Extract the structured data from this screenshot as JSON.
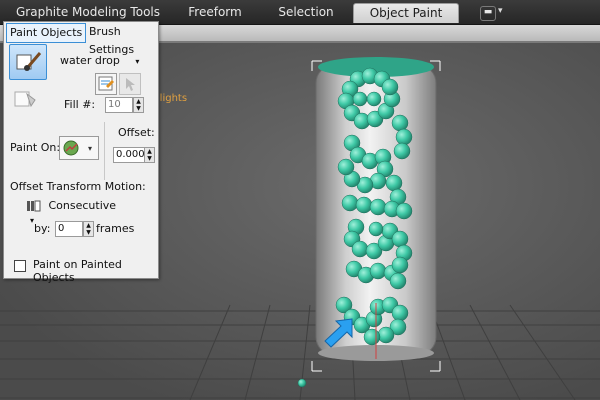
{
  "ribbon": {
    "tabs": [
      {
        "label": "Graphite Modeling Tools",
        "active": false
      },
      {
        "label": "Freeform",
        "active": false
      },
      {
        "label": "Selection",
        "active": false
      },
      {
        "label": "Object Paint",
        "active": true
      }
    ],
    "dropdown_label": "▬"
  },
  "viewport": {
    "highlight_label": "ghlights"
  },
  "panel": {
    "tabs": [
      "Paint Objects",
      "Brush Settings"
    ],
    "object_dropdown": "water drop",
    "fill_label": "Fill #:",
    "fill_value": "10",
    "paint_on_label": "Paint On:",
    "offset_label": "Offset:",
    "offset_value": "0.000",
    "offset_transform_label": "Offset Transform Motion:",
    "motion_dropdown": "Consecutive",
    "by_label": "by:",
    "by_value": "0",
    "frames_label": "frames",
    "paint_on_painted_label": "Paint on Painted Objects",
    "paint_on_painted_checked": false
  },
  "colors": {
    "accent": "#3b8fd6",
    "drop_teal": "#3fc9a6",
    "highlight": "#e0a040"
  }
}
